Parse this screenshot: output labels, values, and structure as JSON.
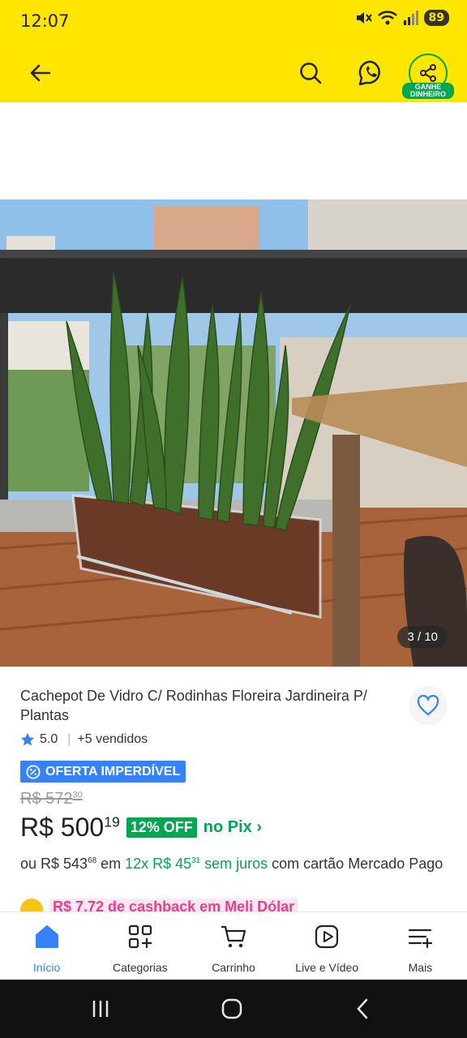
{
  "status": {
    "time": "12:07",
    "battery": "89"
  },
  "header": {
    "earn_badge": "GANHE DINHEIRO"
  },
  "gallery": {
    "counter": "3 / 10"
  },
  "product": {
    "title": "Cachepot De Vidro C/ Rodinhas Floreira Jardineira P/ Plantas",
    "rating": "5.0",
    "sold": "+5 vendidos",
    "deal_badge": "OFERTA IMPERDÍVEL",
    "old_price_int": "R$ 572",
    "old_price_cents": "30",
    "price_int": "R$ 500",
    "price_cents": "19",
    "off": "12% OFF",
    "pix": "no Pix ›",
    "install_prefix": "ou R$ 543",
    "install_prefix_cents": "68",
    "install_mid": " em ",
    "install_green": "12x R$ 45",
    "install_green_cents": "31",
    "install_green2": " sem juros",
    "install_suffix": " com cartão Mercado Pago",
    "cashback": "R$ 7,72 de cashback em Meli Dólar"
  },
  "bottom_nav": {
    "home": "Início",
    "categories": "Categorias",
    "cart": "Carrinho",
    "live": "Live e Vídeo",
    "more": "Mais"
  },
  "colors": {
    "brand_yellow": "#ffe600",
    "accent_blue": "#3483fa",
    "green": "#00a650"
  }
}
